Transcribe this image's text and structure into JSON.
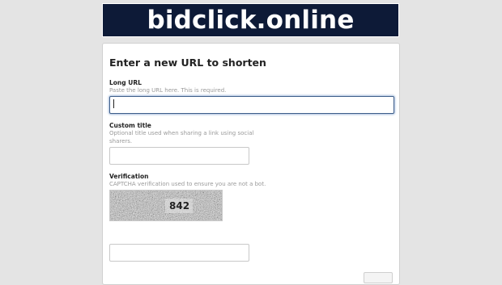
{
  "header": {
    "site_title": "bidclick.online",
    "background_color": "#0d1a37"
  },
  "form": {
    "title": "Enter a new URL to shorten",
    "long_url": {
      "label": "Long URL",
      "help": "Paste the long URL here. This is required.",
      "value": "",
      "placeholder": ""
    },
    "custom_title": {
      "label": "Custom title",
      "help": "Optional title used when sharing a link using social sharers.",
      "value": "",
      "placeholder": ""
    },
    "verification": {
      "label": "Verification",
      "help": "CAPTCHA verification used to ensure you are not a bot.",
      "captcha_text": "842",
      "value": "",
      "placeholder": ""
    },
    "submit_label": ""
  },
  "colors": {
    "focus_border": "#3f5f8a",
    "page_background": "#e4e4e4"
  }
}
